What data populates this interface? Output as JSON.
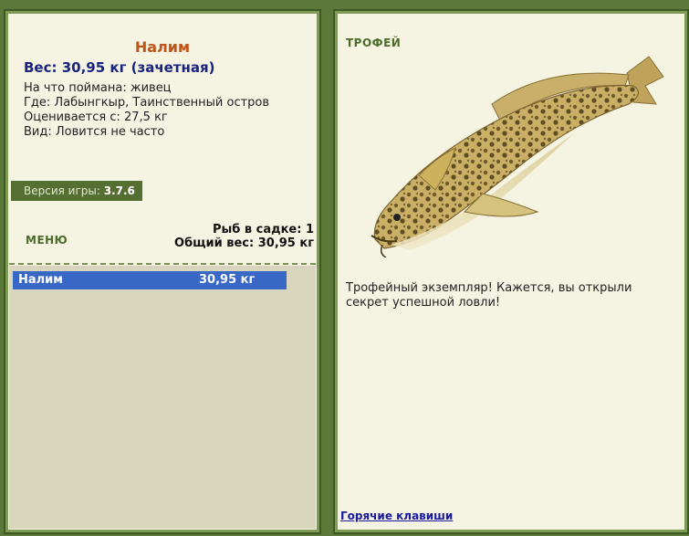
{
  "catch": {
    "title": "Налим",
    "weight": "Вес: 30,95 кг (зачетная)",
    "bait": "На что поймана: живец",
    "location": "Где: Лабынгкыр, Таинственный остров",
    "valued": "Оценивается с: 27,5 кг",
    "kind": "Вид: Ловится не часто"
  },
  "version": {
    "label": "Версия игры:",
    "value": "3.7.6"
  },
  "menu": {
    "label": "МЕНЮ"
  },
  "keepnet": {
    "count": "Рыб в садке: 1",
    "total": "Общий вес: 30,95 кг",
    "items": [
      {
        "name": "Налим",
        "weight": "30,95 кг"
      }
    ]
  },
  "trophy": {
    "label": "ТРОФЕЙ",
    "text": "Трофейный экземпляр! Кажется, вы открыли секрет успешной ловли!"
  },
  "hotkeys": {
    "label": "Горячие клавиши"
  },
  "colors": {
    "frame": "#5b7a3a",
    "panel": "#f5f3e2",
    "highlight": "#3867c6",
    "title": "#c0541a",
    "weight": "#1a237e"
  }
}
